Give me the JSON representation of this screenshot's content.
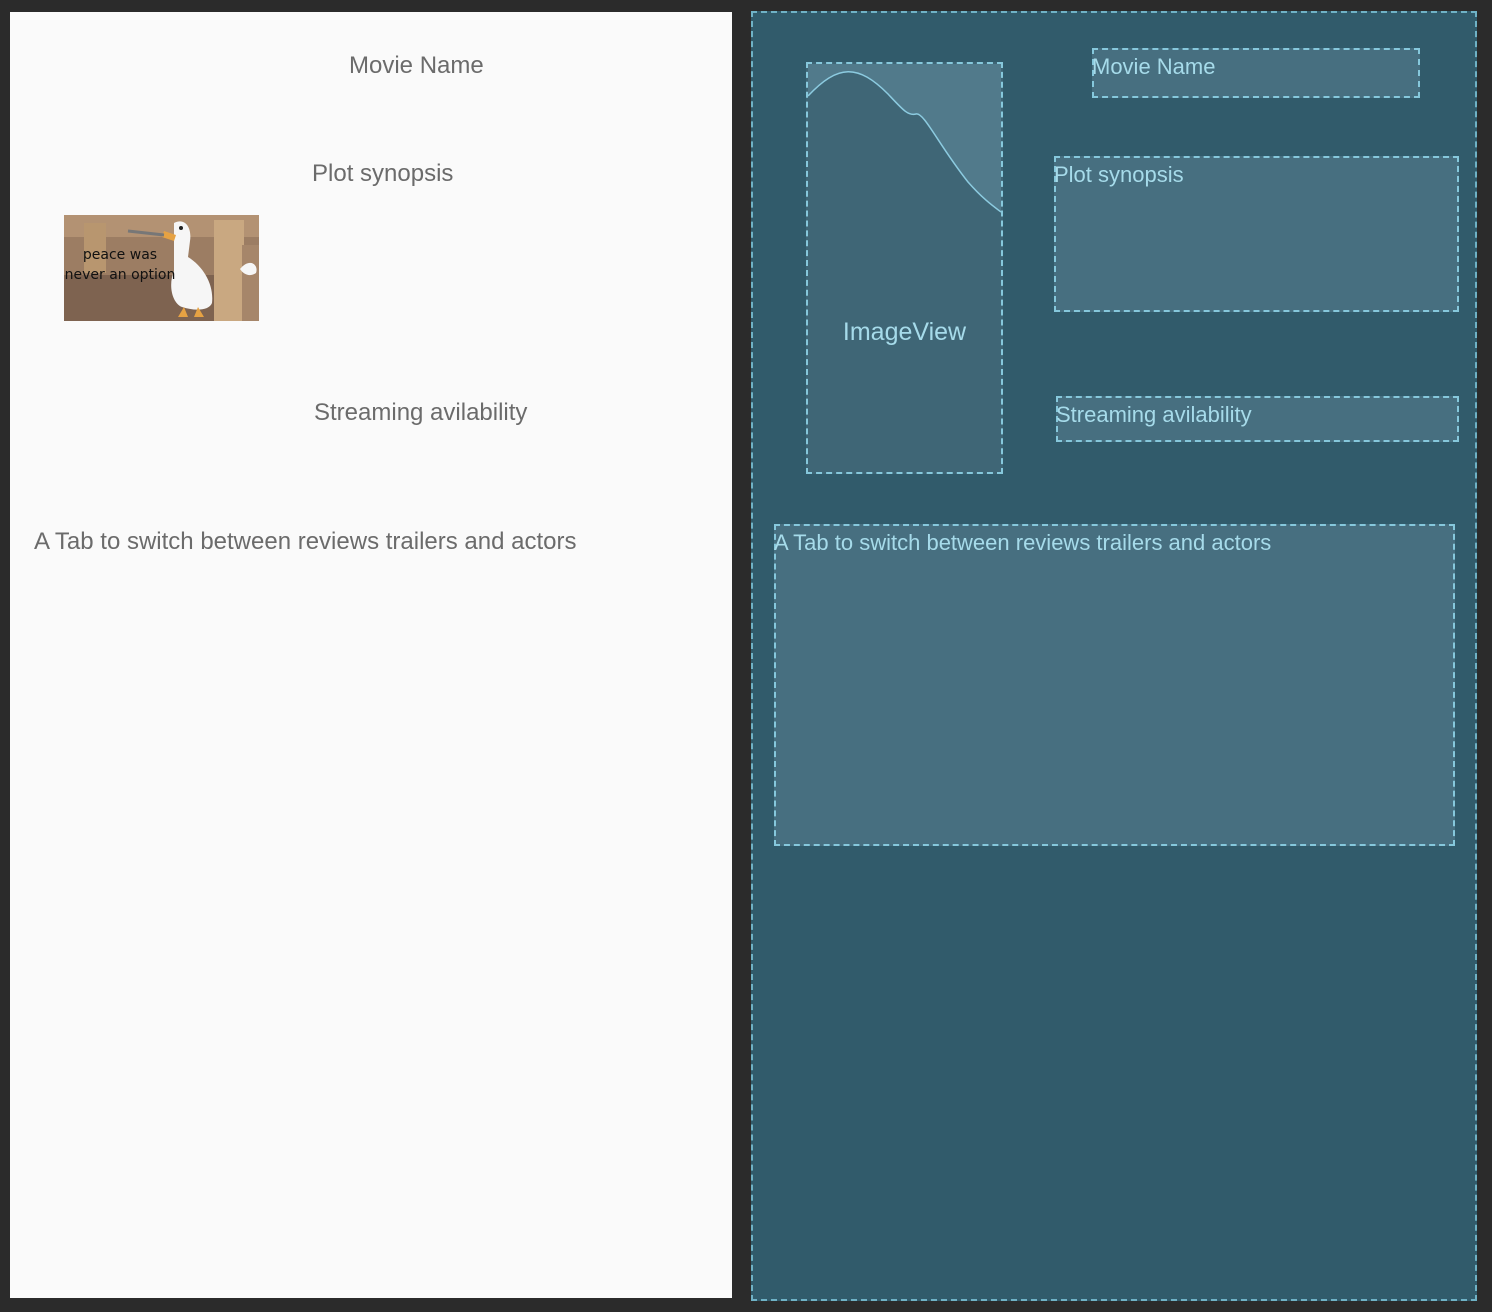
{
  "design": {
    "movie_name": "Movie Name",
    "plot_synopsis": "Plot synopsis",
    "streaming": "Streaming avilability",
    "tab_switch": "A Tab to switch between reviews trailers and actors",
    "poster_caption_line1": "peace was",
    "poster_caption_line2": "never an option"
  },
  "blueprint": {
    "movie_name": "Movie Name",
    "plot_synopsis": "Plot synopsis",
    "streaming": "Streaming avilability",
    "tab_switch": "A Tab to switch between reviews trailers and actors",
    "image_view": "ImageView"
  },
  "colors": {
    "design_background": "#fafafa",
    "design_text": "#6b6b6b",
    "blueprint_background": "#315b6b",
    "blueprint_box": "#476f80",
    "blueprint_outline": "#86c8dc",
    "blueprint_text": "#a6dbea"
  }
}
